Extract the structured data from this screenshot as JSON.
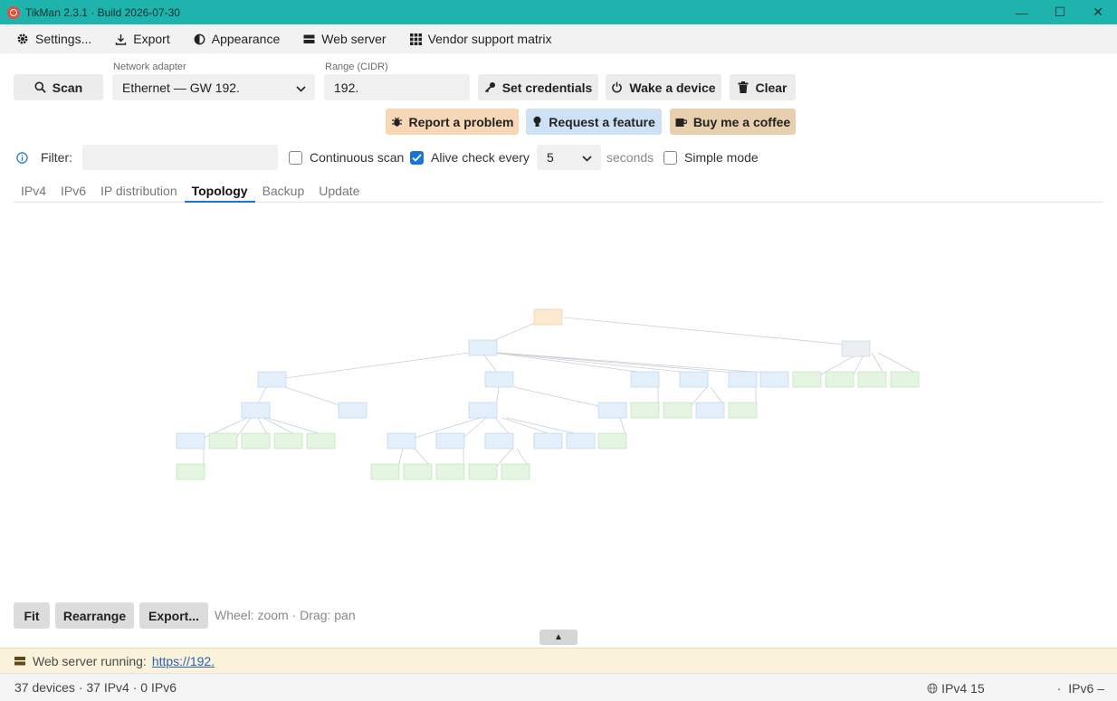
{
  "window": {
    "title": "TikMan 2.3.1 · Build 2026-07-30",
    "minimize": "—",
    "maximize": "☐",
    "close": "✕"
  },
  "menu": {
    "settings": "Settings...",
    "export": "Export",
    "appearance": "Appearance",
    "web_server": "Web server",
    "vendor_matrix": "Vendor support matrix"
  },
  "toolbar": {
    "scan": "Scan",
    "adapter_label": "Network adapter",
    "adapter_value": "Ethernet — GW 192.",
    "range_label": "Range (CIDR)",
    "range_value": "192.",
    "set_credentials": "Set credentials",
    "wake_device": "Wake a device",
    "clear": "Clear",
    "report_problem": "Report a problem",
    "request_feature": "Request a feature",
    "buy_coffee": "Buy me a coffee"
  },
  "filter": {
    "label": "Filter:",
    "value": "",
    "continuous_scan": "Continuous scan",
    "continuous_scan_checked": false,
    "alive_check": "Alive check every",
    "alive_check_checked": true,
    "interval": "5",
    "seconds": "seconds",
    "simple_mode": "Simple mode",
    "simple_mode_checked": false
  },
  "tabs": [
    "IPv4",
    "IPv6",
    "IP distribution",
    "Topology",
    "Backup",
    "Update"
  ],
  "active_tab": "Topology",
  "topology_actions": {
    "fit": "Fit",
    "rearrange": "Rearrange",
    "export": "Export...",
    "hint": "Wheel: zoom · Drag: pan",
    "expand": "▲"
  },
  "banner": {
    "text": "Web server running:",
    "link": "https://192."
  },
  "status": {
    "counts": "37 devices · 37 IPv4 · 0 IPv6",
    "ipv4": "IPv4 15",
    "ipv6": "IPv6 –",
    "sep": "·"
  },
  "colors": {
    "titlebar": "#1fb3ad",
    "accent": "#1a73d9",
    "report_bg": "#f7d7b5",
    "request_bg": "#cfe1f4",
    "coffee_bg": "#e8cfae",
    "node_root": "#fde9d2",
    "node_router": "#e3effa",
    "node_leaf": "#e4f5e1",
    "node_gray": "#eceff2"
  }
}
